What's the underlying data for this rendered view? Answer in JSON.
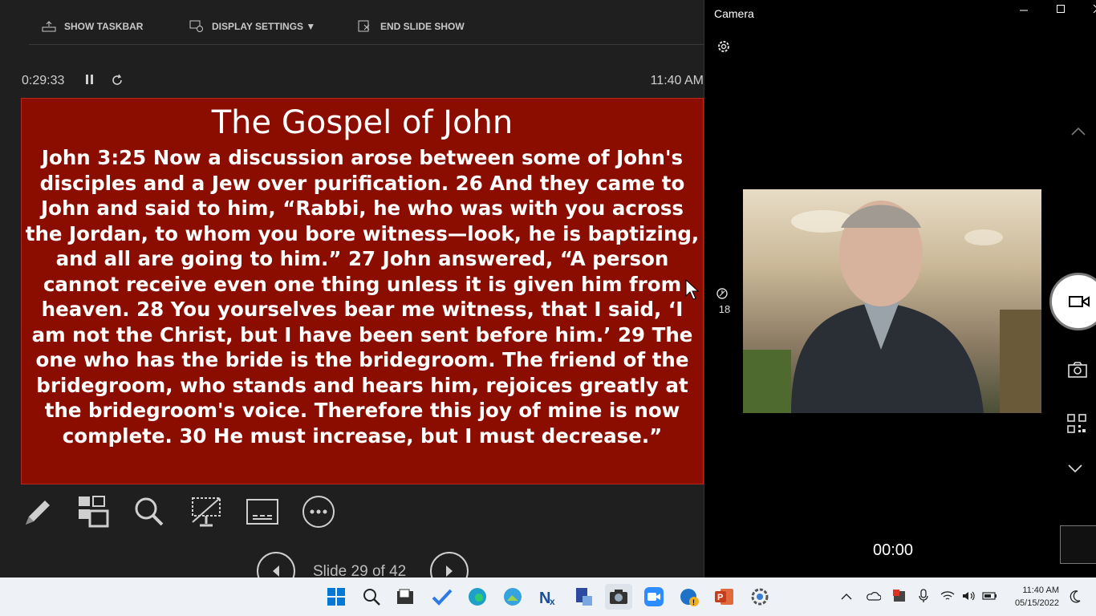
{
  "presenter": {
    "toolbar": {
      "show_taskbar": "SHOW TASKBAR",
      "display_settings": "DISPLAY SETTINGS ▼",
      "end_slide_show": "END SLIDE SHOW"
    },
    "elapsed": "0:29:33",
    "clock": "11:40 AM",
    "slide": {
      "title": "The Gospel of John",
      "body": "John 3:25 Now a discussion arose between some of John's disciples and a Jew over purification. 26 And they came to John and said to him, “Rabbi, he who was with you across the Jordan, to whom you bore witness—look, he is baptizing, and all are going to him.” 27 John answered, “A person cannot receive even one thing unless it is given him from heaven. 28 You yourselves bear me witness, that I said, ‘I am not the Christ, but I have been sent before him.’ 29 The one who has the bride is the bridegroom. The friend of the bridegroom, who stands and hears him, rejoices greatly at the bridegroom's voice. Therefore this joy of mine is now complete. 30 He must increase, but I must decrease.”",
      "background": "#8b0d00"
    },
    "tools": [
      "pen-icon",
      "slides-grid-icon",
      "zoom-icon",
      "camera-off-icon",
      "subtitles-icon",
      "more-icon"
    ],
    "slide_counter": "Slide 29 of 42"
  },
  "camera": {
    "title": "Camera",
    "counter": "18",
    "record_timer": "00:00"
  },
  "taskbar": {
    "apps": [
      "start-icon",
      "search-icon",
      "file-explorer-icon",
      "todo-icon",
      "edge-icon",
      "photos-icon",
      "news-icon",
      "snip-icon",
      "camera-app-icon",
      "zoom-icon",
      "security-icon",
      "powerpoint-icon",
      "settings-icon"
    ],
    "time": "11:40 AM",
    "date": "05/15/2022"
  }
}
